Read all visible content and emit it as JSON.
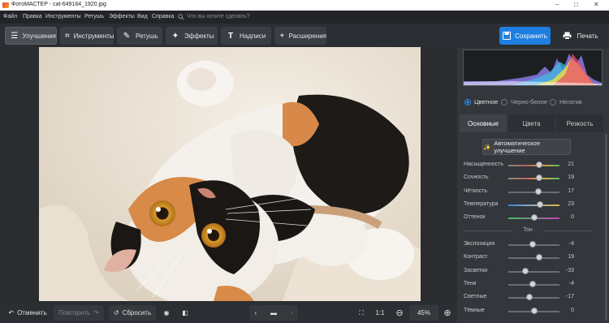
{
  "titlebar": {
    "title": "ФотоМАСТЕР - cat-649164_1920.jpg",
    "minimize": "–",
    "maximize": "□",
    "close": "✕"
  },
  "menu": {
    "items": [
      "Файл",
      "Правка",
      "Инструменты",
      "Ретушь",
      "Эффекты",
      "Вид",
      "Справка"
    ],
    "search_placeholder": "Что вы хотите сделать?"
  },
  "toolbar": {
    "tabs": [
      "Улучшения",
      "Инструменты",
      "Ретушь",
      "Эффекты",
      "Надписи",
      "Расширения"
    ],
    "save_label": "Сохранить",
    "print_label": "Печать"
  },
  "bottom": {
    "undo_label": "Отменить",
    "redo_label": "Повторить",
    "reset_label": "Сбросить",
    "ratio_label": "1:1",
    "zoom": "45%"
  },
  "panel": {
    "modes": [
      "Цветное",
      "Черно-белое",
      "Негатив"
    ],
    "selected_mode": "Цветное",
    "tabs": [
      "Основные",
      "Цвета",
      "Резкость"
    ],
    "auto_button": "Автоматическое улучшение",
    "sliders": [
      {
        "label": "Насыщенность",
        "value": "21",
        "fraction": 0.61
      },
      {
        "label": "Сочность",
        "value": "19",
        "fraction": 0.6
      },
      {
        "label": "Чёткость",
        "value": "17",
        "fraction": 0.59
      },
      {
        "label": "Температура",
        "value": "23",
        "fraction": 0.62
      },
      {
        "label": "Оттенок",
        "value": "0",
        "fraction": 0.5
      }
    ],
    "tone_title": "Тон",
    "tone_sliders": [
      {
        "label": "Экспозиция",
        "value": "-4",
        "fraction": 0.48
      },
      {
        "label": "Контраст",
        "value": "19",
        "fraction": 0.6
      },
      {
        "label": "Засветки",
        "value": "-33",
        "fraction": 0.33
      },
      {
        "label": "Тени",
        "value": "-4",
        "fraction": 0.48
      },
      {
        "label": "Светлые",
        "value": "-17",
        "fraction": 0.41
      },
      {
        "label": "Тёмные",
        "value": "0",
        "fraction": 0.5
      }
    ]
  },
  "colors": {
    "accent": "#1f7fe0",
    "bg": "#3a3d42",
    "panel": "#33363b"
  }
}
